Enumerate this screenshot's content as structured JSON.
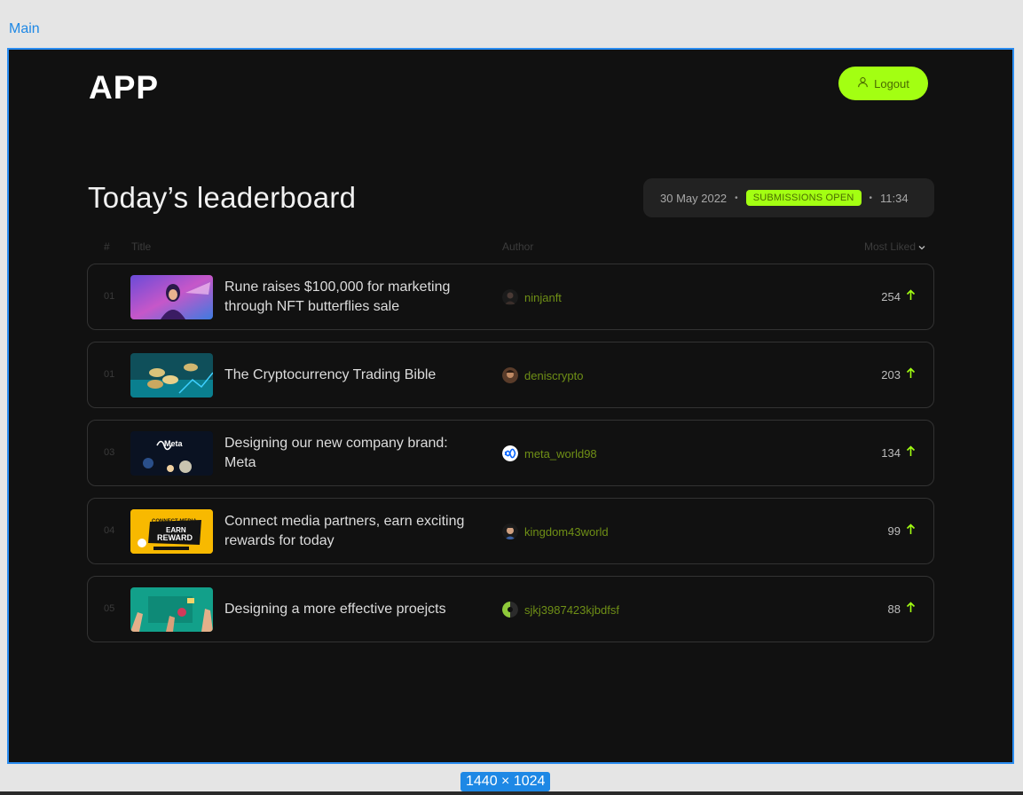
{
  "canvas": {
    "frame_label": "Main",
    "size_label": "1440 × 1024"
  },
  "header": {
    "logo": "APP",
    "logout_label": "Logout"
  },
  "page": {
    "title": "Today’s leaderboard",
    "date": "30 May 2022",
    "status_badge": "SUBMISSIONS OPEN",
    "time": "11:34"
  },
  "table": {
    "col_num": "#",
    "col_title": "Title",
    "col_author": "Author",
    "col_sort": "Most Liked",
    "rows": [
      {
        "rank": "01",
        "title": "Rune raises $100,000 for marketing through NFT butterflies sale",
        "author": "ninjanft",
        "likes": "254",
        "thumb_icon": "nft-character-thumbnail",
        "avatar_icon": "ninjanft-avatar"
      },
      {
        "rank": "01",
        "title": "The Cryptocurrency Trading Bible",
        "author": "deniscrypto",
        "likes": "203",
        "thumb_icon": "crypto-coins-thumbnail",
        "avatar_icon": "deniscrypto-avatar"
      },
      {
        "rank": "03",
        "title": "Designing our new company brand: Meta",
        "author": "meta_world98",
        "likes": "134",
        "thumb_icon": "meta-brand-thumbnail",
        "avatar_icon": "meta-logo-avatar",
        "thumb_text": "Meta"
      },
      {
        "rank": "04",
        "title": "Connect media partners, earn exciting rewards  for today",
        "author": "kingdom43world",
        "likes": "99",
        "thumb_icon": "earn-reward-thumbnail",
        "avatar_icon": "kingdom43world-avatar",
        "thumb_text_1": "CONNECT MEDIA",
        "thumb_text_2": "EARN",
        "thumb_text_3": "REWARD"
      },
      {
        "rank": "05",
        "title": "Designing a more effective proejcts",
        "author": "sjkj3987423kjbdfsf",
        "likes": "88",
        "thumb_icon": "team-planning-thumbnail",
        "avatar_icon": "sjkj-avatar"
      }
    ]
  },
  "colors": {
    "accent": "#a3ff12",
    "background": "#111111",
    "author_text": "#6f8f16",
    "arrow": "#a3ff12"
  }
}
